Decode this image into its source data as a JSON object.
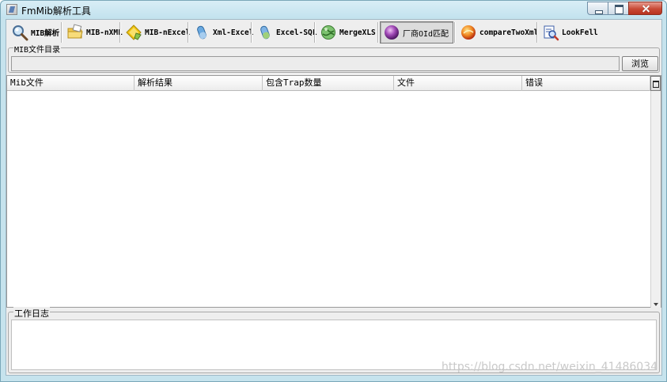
{
  "window": {
    "title": "FmMib解析工具"
  },
  "toolbar": {
    "buttons": [
      {
        "label": "MIB解析",
        "icon": "magnifier-icon"
      },
      {
        "label": "MIB-nXML",
        "icon": "folder-icon"
      },
      {
        "label": "MIB-nExcel",
        "icon": "diamond-icon"
      },
      {
        "label": "Xml-Excel",
        "icon": "blue-capsule-icon"
      },
      {
        "label": "Excel-SQL",
        "icon": "capsule-icon"
      },
      {
        "label": "MergeXLS",
        "icon": "globe-icon"
      },
      {
        "label": "厂商OId匹配",
        "icon": "purple-orb-icon",
        "pressed": true
      },
      {
        "label": "compareTwoXml",
        "icon": "fire-orb-icon"
      },
      {
        "label": "LookFell",
        "icon": "search-document-icon"
      }
    ]
  },
  "mib_dir": {
    "label": "MIB文件目录",
    "path_value": "",
    "browse_label": "浏览"
  },
  "table": {
    "columns": [
      "Mib文件",
      "解析结果",
      "包含Trap数量",
      "文件",
      "错误"
    ],
    "rows": []
  },
  "log": {
    "label": "工作日志",
    "content": ""
  },
  "watermark": "https://blog.csdn.net/weixin_41486034"
}
